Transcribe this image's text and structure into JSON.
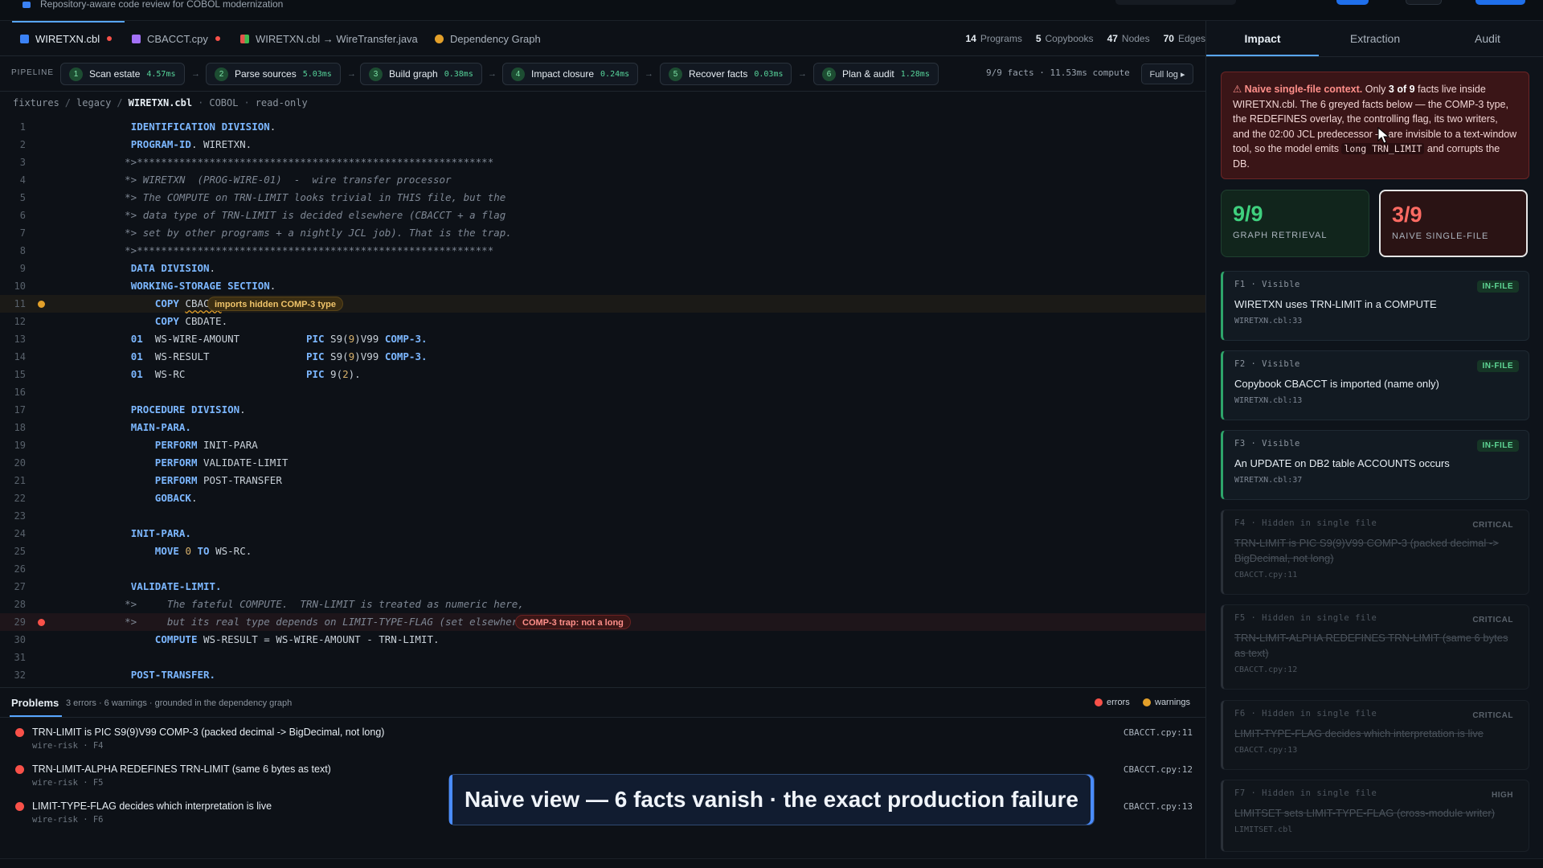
{
  "topbar": {
    "project_title": "Repository-aware code review for COBOL modernization",
    "controls": [
      {
        "color": "#1f6feb"
      },
      {
        "color": "#1b2129"
      },
      {
        "color": "#1f6feb"
      }
    ]
  },
  "tabs": [
    {
      "label": "WIRETXN.cbl",
      "color": "#3b82f6",
      "modified": true,
      "active": true
    },
    {
      "label": "CBACCT.cpy",
      "color": "#a371f7",
      "modified": true,
      "active": false
    },
    {
      "label": "WIRETXN.cbl → WireTransfer.java",
      "color": "#e5534b",
      "modified": false,
      "active": false
    },
    {
      "label": "Dependency Graph",
      "color": "#e3a02a",
      "modified": false,
      "active": false
    }
  ],
  "stats": [
    {
      "value": "14",
      "label": "Programs"
    },
    {
      "value": "5",
      "label": "Copybooks"
    },
    {
      "value": "47",
      "label": "Nodes"
    },
    {
      "value": "70",
      "label": "Edges"
    }
  ],
  "pipeline": {
    "label": "PIPELINE",
    "steps": [
      {
        "num": "1",
        "name": "Scan estate",
        "time": "4.57ms"
      },
      {
        "num": "2",
        "name": "Parse sources",
        "time": "5.03ms"
      },
      {
        "num": "3",
        "name": "Build graph",
        "time": "0.38ms"
      },
      {
        "num": "4",
        "name": "Impact closure",
        "time": "0.24ms"
      },
      {
        "num": "5",
        "name": "Recover facts",
        "time": "0.03ms"
      },
      {
        "num": "6",
        "name": "Plan & audit",
        "time": "1.28ms"
      }
    ],
    "summary": "9/9 facts · 11.53ms compute",
    "full_log": "Full log ▸"
  },
  "breadcrumb": {
    "parts": [
      "fixtures",
      "legacy",
      "WIRETXN.cbl"
    ],
    "lang": "COBOL",
    "mode": "read-only"
  },
  "code_lines": [
    {
      "n": "1",
      "t": "       IDENTIFICATION DIVISION.",
      "k": "kw"
    },
    {
      "n": "2",
      "t": "       PROGRAM-ID. WIRETXN.",
      "k": "kw"
    },
    {
      "n": "3",
      "t": "      *>***********************************************************",
      "k": "cm"
    },
    {
      "n": "4",
      "t": "      *> WIRETXN  (PROG-WIRE-01)  -  wire transfer processor",
      "k": "cm"
    },
    {
      "n": "5",
      "t": "      *> The COMPUTE on TRN-LIMIT looks trivial in THIS file, but the",
      "k": "cm"
    },
    {
      "n": "6",
      "t": "      *> data type of TRN-LIMIT is decided elsewhere (CBACCT + a flag",
      "k": "cm"
    },
    {
      "n": "7",
      "t": "      *> set by other programs + a nightly JCL job). That is the trap.",
      "k": "cm"
    },
    {
      "n": "8",
      "t": "      *>***********************************************************",
      "k": "cm"
    },
    {
      "n": "9",
      "t": "       DATA DIVISION.",
      "k": "kw"
    },
    {
      "n": "10",
      "t": "       WORKING-STORAGE SECTION.",
      "k": "kw"
    },
    {
      "n": "11",
      "t": "           COPY CBACCT.",
      "k": "kw"
    },
    {
      "n": "12",
      "t": "           COPY CBDATE.",
      "k": "kw"
    },
    {
      "n": "13",
      "t": "       01  WS-WIRE-AMOUNT           PIC S9(9)V99 COMP-3.",
      "k": "pic"
    },
    {
      "n": "14",
      "t": "       01  WS-RESULT                PIC S9(9)V99 COMP-3.",
      "k": "pic"
    },
    {
      "n": "15",
      "t": "       01  WS-RC                    PIC 9(2).",
      "k": "pic"
    },
    {
      "n": "16",
      "t": "",
      "k": "plain"
    },
    {
      "n": "17",
      "t": "       PROCEDURE DIVISION.",
      "k": "kw"
    },
    {
      "n": "18",
      "t": "       MAIN-PARA.",
      "k": "kw"
    },
    {
      "n": "19",
      "t": "           PERFORM INIT-PARA",
      "k": "kw"
    },
    {
      "n": "20",
      "t": "           PERFORM VALIDATE-LIMIT",
      "k": "kw"
    },
    {
      "n": "21",
      "t": "           PERFORM POST-TRANSFER",
      "k": "kw"
    },
    {
      "n": "22",
      "t": "           GOBACK.",
      "k": "kw"
    },
    {
      "n": "23",
      "t": "",
      "k": "plain"
    },
    {
      "n": "24",
      "t": "       INIT-PARA.",
      "k": "kw"
    },
    {
      "n": "25",
      "t": "           MOVE 0 TO WS-RC.",
      "k": "kw"
    },
    {
      "n": "26",
      "t": "",
      "k": "plain"
    },
    {
      "n": "27",
      "t": "       VALIDATE-LIMIT.",
      "k": "kw"
    },
    {
      "n": "28",
      "t": "      *>     The fateful COMPUTE.  TRN-LIMIT is treated as numeric here,",
      "k": "cm"
    },
    {
      "n": "29",
      "t": "      *>     but its real type depends on LIMIT-TYPE-FLAG (set elsewhere).",
      "k": "cm"
    },
    {
      "n": "30",
      "t": "           COMPUTE WS-RESULT = WS-WIRE-AMOUNT - TRN-LIMIT.",
      "k": "kw"
    },
    {
      "n": "31",
      "t": "",
      "k": "plain"
    },
    {
      "n": "32",
      "t": "       POST-TRANSFER.",
      "k": "kw"
    }
  ],
  "annotations": {
    "line11": "imports hidden COMP-3 type",
    "line29": "COMP-3 trap: not a long"
  },
  "problems": {
    "title": "Problems",
    "summary": "3 errors · 6 warnings · grounded in the dependency graph",
    "legend_errors": "errors",
    "legend_warnings": "warnings",
    "items": [
      {
        "msg": "TRN-LIMIT is PIC S9(9)V99 COMP-3 (packed decimal -> BigDecimal, not long)",
        "meta": "wire-risk · F4",
        "loc": "CBACCT.cpy:11"
      },
      {
        "msg": "TRN-LIMIT-ALPHA REDEFINES TRN-LIMIT (same 6 bytes as text)",
        "meta": "wire-risk · F5",
        "loc": "CBACCT.cpy:12"
      },
      {
        "msg": "LIMIT-TYPE-FLAG decides which interpretation is live",
        "meta": "wire-risk · F6",
        "loc": "CBACCT.cpy:13"
      }
    ]
  },
  "caption": "Naive view — 6 facts vanish · the exact production failure",
  "side": {
    "tabs": [
      "Impact",
      "Extraction",
      "Audit"
    ],
    "alert": {
      "lead": "⚠ Naive single-file context.",
      "p1": " Only ",
      "bold1": "3 of 9",
      "p2": " facts live inside WIRETXN.cbl. The 6 greyed facts below — the COMP-3 type, the REDEFINES overlay, the controlling flag, its two writers, and the 02:00 JCL predecessor — are invisible to a text-window tool, so the model emits ",
      "code1": "long TRN_LIMIT",
      "p3": " and corrupts the DB."
    },
    "scores": [
      {
        "value": "9/9",
        "label": "GRAPH RETRIEVAL"
      },
      {
        "value": "3/9",
        "label": "NAIVE SINGLE-FILE"
      }
    ],
    "facts": [
      {
        "head": "F1 · Visible",
        "title": "WIRETXN uses TRN-LIMIT in a COMPUTE",
        "src": "WIRETXN.cbl:33",
        "tag": "IN-FILE",
        "hidden": false
      },
      {
        "head": "F2 · Visible",
        "title": "Copybook CBACCT is imported (name only)",
        "src": "WIRETXN.cbl:13",
        "tag": "IN-FILE",
        "hidden": false
      },
      {
        "head": "F3 · Visible",
        "title": "An UPDATE on DB2 table ACCOUNTS occurs",
        "src": "WIRETXN.cbl:37",
        "tag": "IN-FILE",
        "hidden": false
      },
      {
        "head": "F4 · Hidden in single file",
        "title": "TRN-LIMIT is PIC S9(9)V99 COMP-3 (packed decimal -> BigDecimal, not long)",
        "src": "CBACCT.cpy:11",
        "tag": "CRITICAL",
        "hidden": true
      },
      {
        "head": "F5 · Hidden in single file",
        "title": "TRN-LIMIT-ALPHA REDEFINES TRN-LIMIT (same 6 bytes as text)",
        "src": "CBACCT.cpy:12",
        "tag": "CRITICAL",
        "hidden": true
      },
      {
        "head": "F6 · Hidden in single file",
        "title": "LIMIT-TYPE-FLAG decides which interpretation is live",
        "src": "CBACCT.cpy:13",
        "tag": "CRITICAL",
        "hidden": true
      },
      {
        "head": "F7 · Hidden in single file",
        "title": "LIMITSET sets LIMIT-TYPE-FLAG (cross-module writer)",
        "src": "LIMITSET.cbl",
        "tag": "HIGH",
        "hidden": true
      }
    ]
  }
}
